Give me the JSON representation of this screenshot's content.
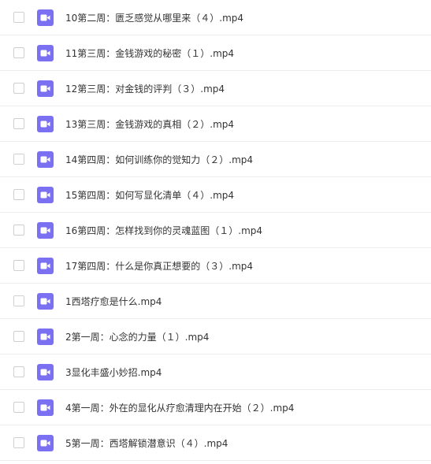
{
  "file_list": {
    "icon": "video-file-icon",
    "icon_color": "#7b6ff2",
    "items": [
      {
        "name": "10第二周：匮乏感觉从哪里来（４）.mp4"
      },
      {
        "name": "11第三周：金钱游戏的秘密（１）.mp4"
      },
      {
        "name": "12第三周：对金钱的评判（３）.mp4"
      },
      {
        "name": "13第三周：金钱游戏的真相（２）.mp4"
      },
      {
        "name": "14第四周：如何训练你的觉知力（２）.mp4"
      },
      {
        "name": "15第四周：如何写显化清单（４）.mp4"
      },
      {
        "name": "16第四周：怎样找到你的灵魂蓝图（１）.mp4"
      },
      {
        "name": "17第四周：什么是你真正想要的（３）.mp4"
      },
      {
        "name": "1西塔疗愈是什么.mp4"
      },
      {
        "name": "2第一周：心念的力量（１）.mp4"
      },
      {
        "name": "3显化丰盛小妙招.mp4"
      },
      {
        "name": "4第一周：外在的显化从疗愈清理内在开始（２）.mp4"
      },
      {
        "name": "5第一周：西塔解锁潜意识（４）.mp4"
      }
    ]
  }
}
